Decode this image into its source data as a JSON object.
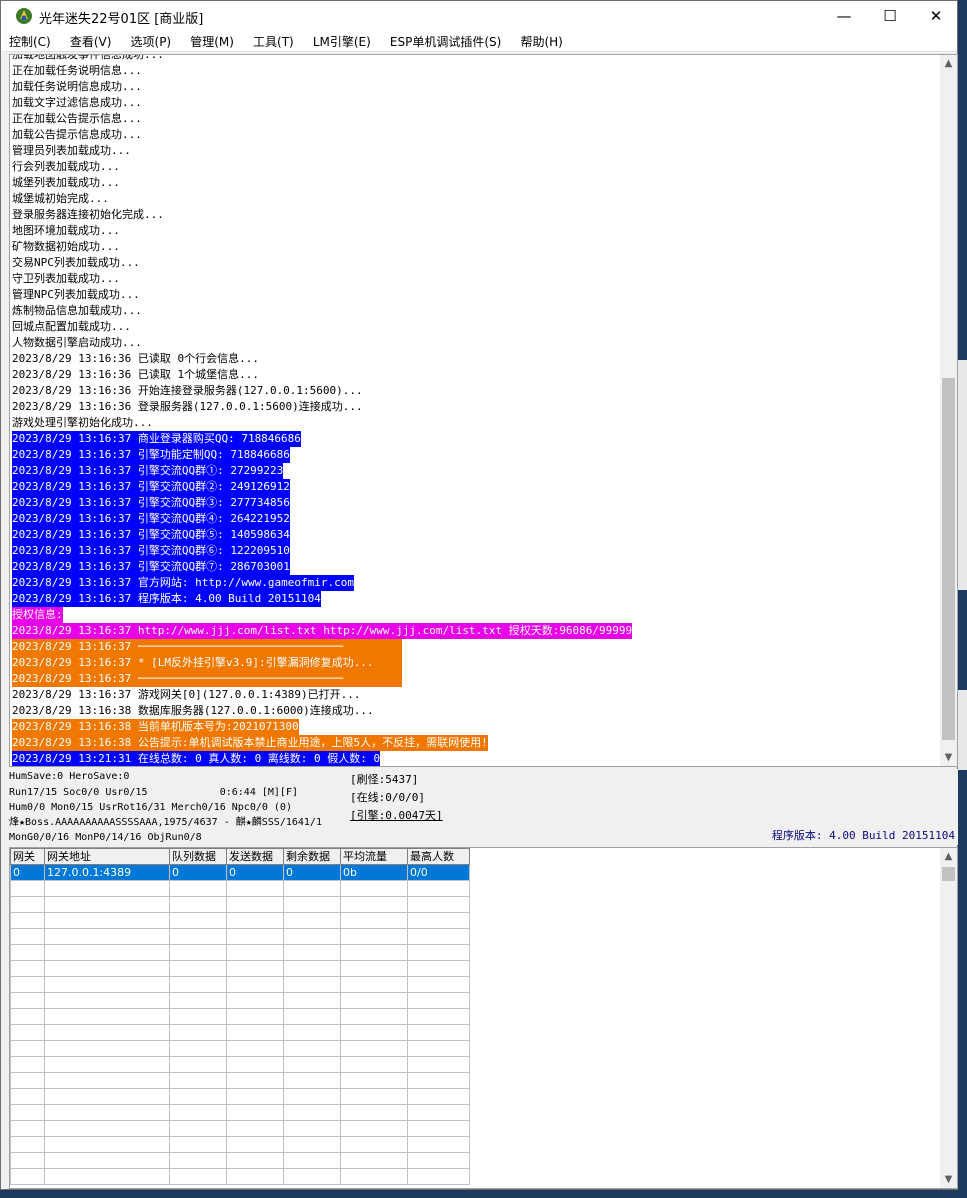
{
  "window": {
    "title": "光年迷失22号01区 [商业版]",
    "controls": {
      "minimize": "—",
      "maximize": "☐",
      "close": "✕"
    }
  },
  "menu": [
    "控制(C)",
    "查看(V)",
    "选项(P)",
    "管理(M)",
    "工具(T)",
    "LM引擎(E)",
    "ESP单机调试插件(S)",
    "帮助(H)"
  ],
  "log": [
    {
      "text": "加载地图触发事件信息成功...",
      "style": "plain"
    },
    {
      "text": "正在加载任务说明信息...",
      "style": "plain"
    },
    {
      "text": "加载任务说明信息成功...",
      "style": "plain"
    },
    {
      "text": "加载文字过滤信息成功...",
      "style": "plain"
    },
    {
      "text": "正在加载公告提示信息...",
      "style": "plain"
    },
    {
      "text": "加载公告提示信息成功...",
      "style": "plain"
    },
    {
      "text": "管理员列表加载成功...",
      "style": "plain"
    },
    {
      "text": "行会列表加载成功...",
      "style": "plain"
    },
    {
      "text": "城堡列表加载成功...",
      "style": "plain"
    },
    {
      "text": "城堡城初始完成...",
      "style": "plain"
    },
    {
      "text": "登录服务器连接初始化完成...",
      "style": "plain"
    },
    {
      "text": "地图环境加载成功...",
      "style": "plain"
    },
    {
      "text": "矿物数据初始成功...",
      "style": "plain"
    },
    {
      "text": "交易NPC列表加载成功...",
      "style": "plain"
    },
    {
      "text": "守卫列表加载成功...",
      "style": "plain"
    },
    {
      "text": "管理NPC列表加载成功...",
      "style": "plain"
    },
    {
      "text": "炼制物品信息加载成功...",
      "style": "plain"
    },
    {
      "text": "回城点配置加载成功...",
      "style": "plain"
    },
    {
      "text": "人物数据引擎启动成功...",
      "style": "plain"
    },
    {
      "text": "2023/8/29 13:16:36 已读取 0个行会信息...",
      "style": "plain"
    },
    {
      "text": "2023/8/29 13:16:36 已读取 1个城堡信息...",
      "style": "plain"
    },
    {
      "text": "2023/8/29 13:16:36 开始连接登录服务器(127.0.0.1:5600)...",
      "style": "plain"
    },
    {
      "text": "2023/8/29 13:16:36 登录服务器(127.0.0.1:5600)连接成功...",
      "style": "plain"
    },
    {
      "text": "游戏处理引擎初始化成功...",
      "style": "plain"
    },
    {
      "text": "2023/8/29 13:16:37 商业登录器购买QQ: 718846686",
      "style": "blue"
    },
    {
      "text": "2023/8/29 13:16:37 引擎功能定制QQ: 718846686",
      "style": "blue"
    },
    {
      "text": "2023/8/29 13:16:37 引擎交流QQ群①: 27299223",
      "style": "blue"
    },
    {
      "text": "2023/8/29 13:16:37 引擎交流QQ群②: 249126912",
      "style": "blue"
    },
    {
      "text": "2023/8/29 13:16:37 引擎交流QQ群③: 277734856",
      "style": "blue"
    },
    {
      "text": "2023/8/29 13:16:37 引擎交流QQ群④: 264221952",
      "style": "blue"
    },
    {
      "text": "2023/8/29 13:16:37 引擎交流QQ群⑤: 140598634",
      "style": "blue"
    },
    {
      "text": "2023/8/29 13:16:37 引擎交流QQ群⑥: 122209510",
      "style": "blue"
    },
    {
      "text": "2023/8/29 13:16:37 引擎交流QQ群⑦: 286703001",
      "style": "blue"
    },
    {
      "text": "2023/8/29 13:16:37 官方网站: http://www.gameofmir.com",
      "style": "blue"
    },
    {
      "text": "2023/8/29 13:16:37 程序版本: 4.00 Build 20151104",
      "style": "blue"
    },
    {
      "text": "授权信息:",
      "style": "magenta"
    },
    {
      "text": "2023/8/29 13:16:37 http://www.jjj.com/list.txt http://www.jjj.com/list.txt 授权天数:96086/99999",
      "style": "magenta"
    },
    {
      "text": "2023/8/29 13:16:37 ───────────────────────────────",
      "style": "orange-bar"
    },
    {
      "text": "2023/8/29 13:16:37 * [LM反外挂引擎v3.9]:引擎漏洞修复成功...",
      "style": "orange-bar"
    },
    {
      "text": "2023/8/29 13:16:37 ───────────────────────────────",
      "style": "orange-bar"
    },
    {
      "text": "2023/8/29 13:16:37 游戏网关[0](127.0.0.1:4389)已打开...",
      "style": "plain"
    },
    {
      "text": "2023/8/29 13:16:38 数据库服务器(127.0.0.1:6000)连接成功...",
      "style": "plain"
    },
    {
      "text": "2023/8/29 13:16:38 当前单机版本号为:2021071300",
      "style": "orange"
    },
    {
      "text": "2023/8/29 13:16:38 公告提示:单机调试版本禁止商业用途，上限5人，不反挂，需联网使用!",
      "style": "orange"
    },
    {
      "text": "2023/8/29 13:21:31 在线总数: 0 真人数: 0 离线数: 0 假人数: 0",
      "style": "blue"
    }
  ],
  "status": {
    "lines": [
      "HumSave:0 HeroSave:0",
      "Run17/15 Soc0/0 Usr0/15            0:6:44 [M][F]",
      "Hum0/0 Mon0/15 UsrRot16/31 Merch0/16 Npc0/0 (0)",
      "烽★Boss.AAAAAAAAAASSSSAAA,1975/4637 - 麒★麟SSS/1641/1",
      "MonG0/0/16 MonP0/14/16 ObjRun0/8"
    ],
    "box": [
      "[刷怪:5437]",
      "[在线:0/0/0]",
      "[引擎:0.0047天]"
    ],
    "version": "程序版本: 4.00 Build 20151104"
  },
  "gateway_table": {
    "headers": [
      "网关",
      "网关地址",
      "队列数据",
      "发送数据",
      "剩余数据",
      "平均流量",
      "最高人数"
    ],
    "rows": [
      [
        "0",
        "127.0.0.1:4389",
        "0",
        "0",
        "0",
        "0b",
        "0/0"
      ]
    ],
    "empty_rows": 19
  }
}
